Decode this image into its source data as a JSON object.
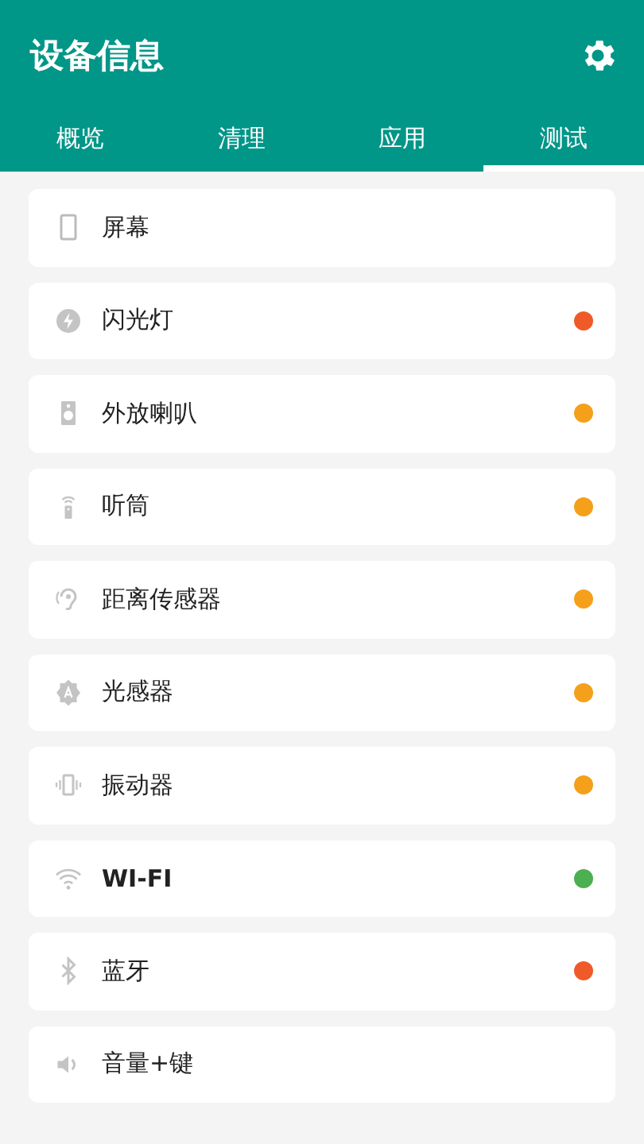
{
  "header": {
    "title": "设备信息"
  },
  "tabs": [
    {
      "label": "概览",
      "selected": false
    },
    {
      "label": "清理",
      "selected": false
    },
    {
      "label": "应用",
      "selected": false
    },
    {
      "label": "测试",
      "selected": true
    }
  ],
  "tests": [
    {
      "label": "屏幕"
    },
    {
      "label": "闪光灯",
      "color": "#f05a28"
    },
    {
      "label": "外放喇叭",
      "color": "#f5a01a"
    },
    {
      "label": "听筒",
      "color": "#f5a01a"
    },
    {
      "label": "距离传感器",
      "color": "#f5a01a"
    },
    {
      "label": "光感器",
      "color": "#f5a01a"
    },
    {
      "label": "振动器",
      "color": "#f5a01a"
    },
    {
      "label": "WI-FI",
      "color": "#4caf50"
    },
    {
      "label": "蓝牙",
      "color": "#f05a28"
    },
    {
      "label": "音量+键"
    }
  ]
}
